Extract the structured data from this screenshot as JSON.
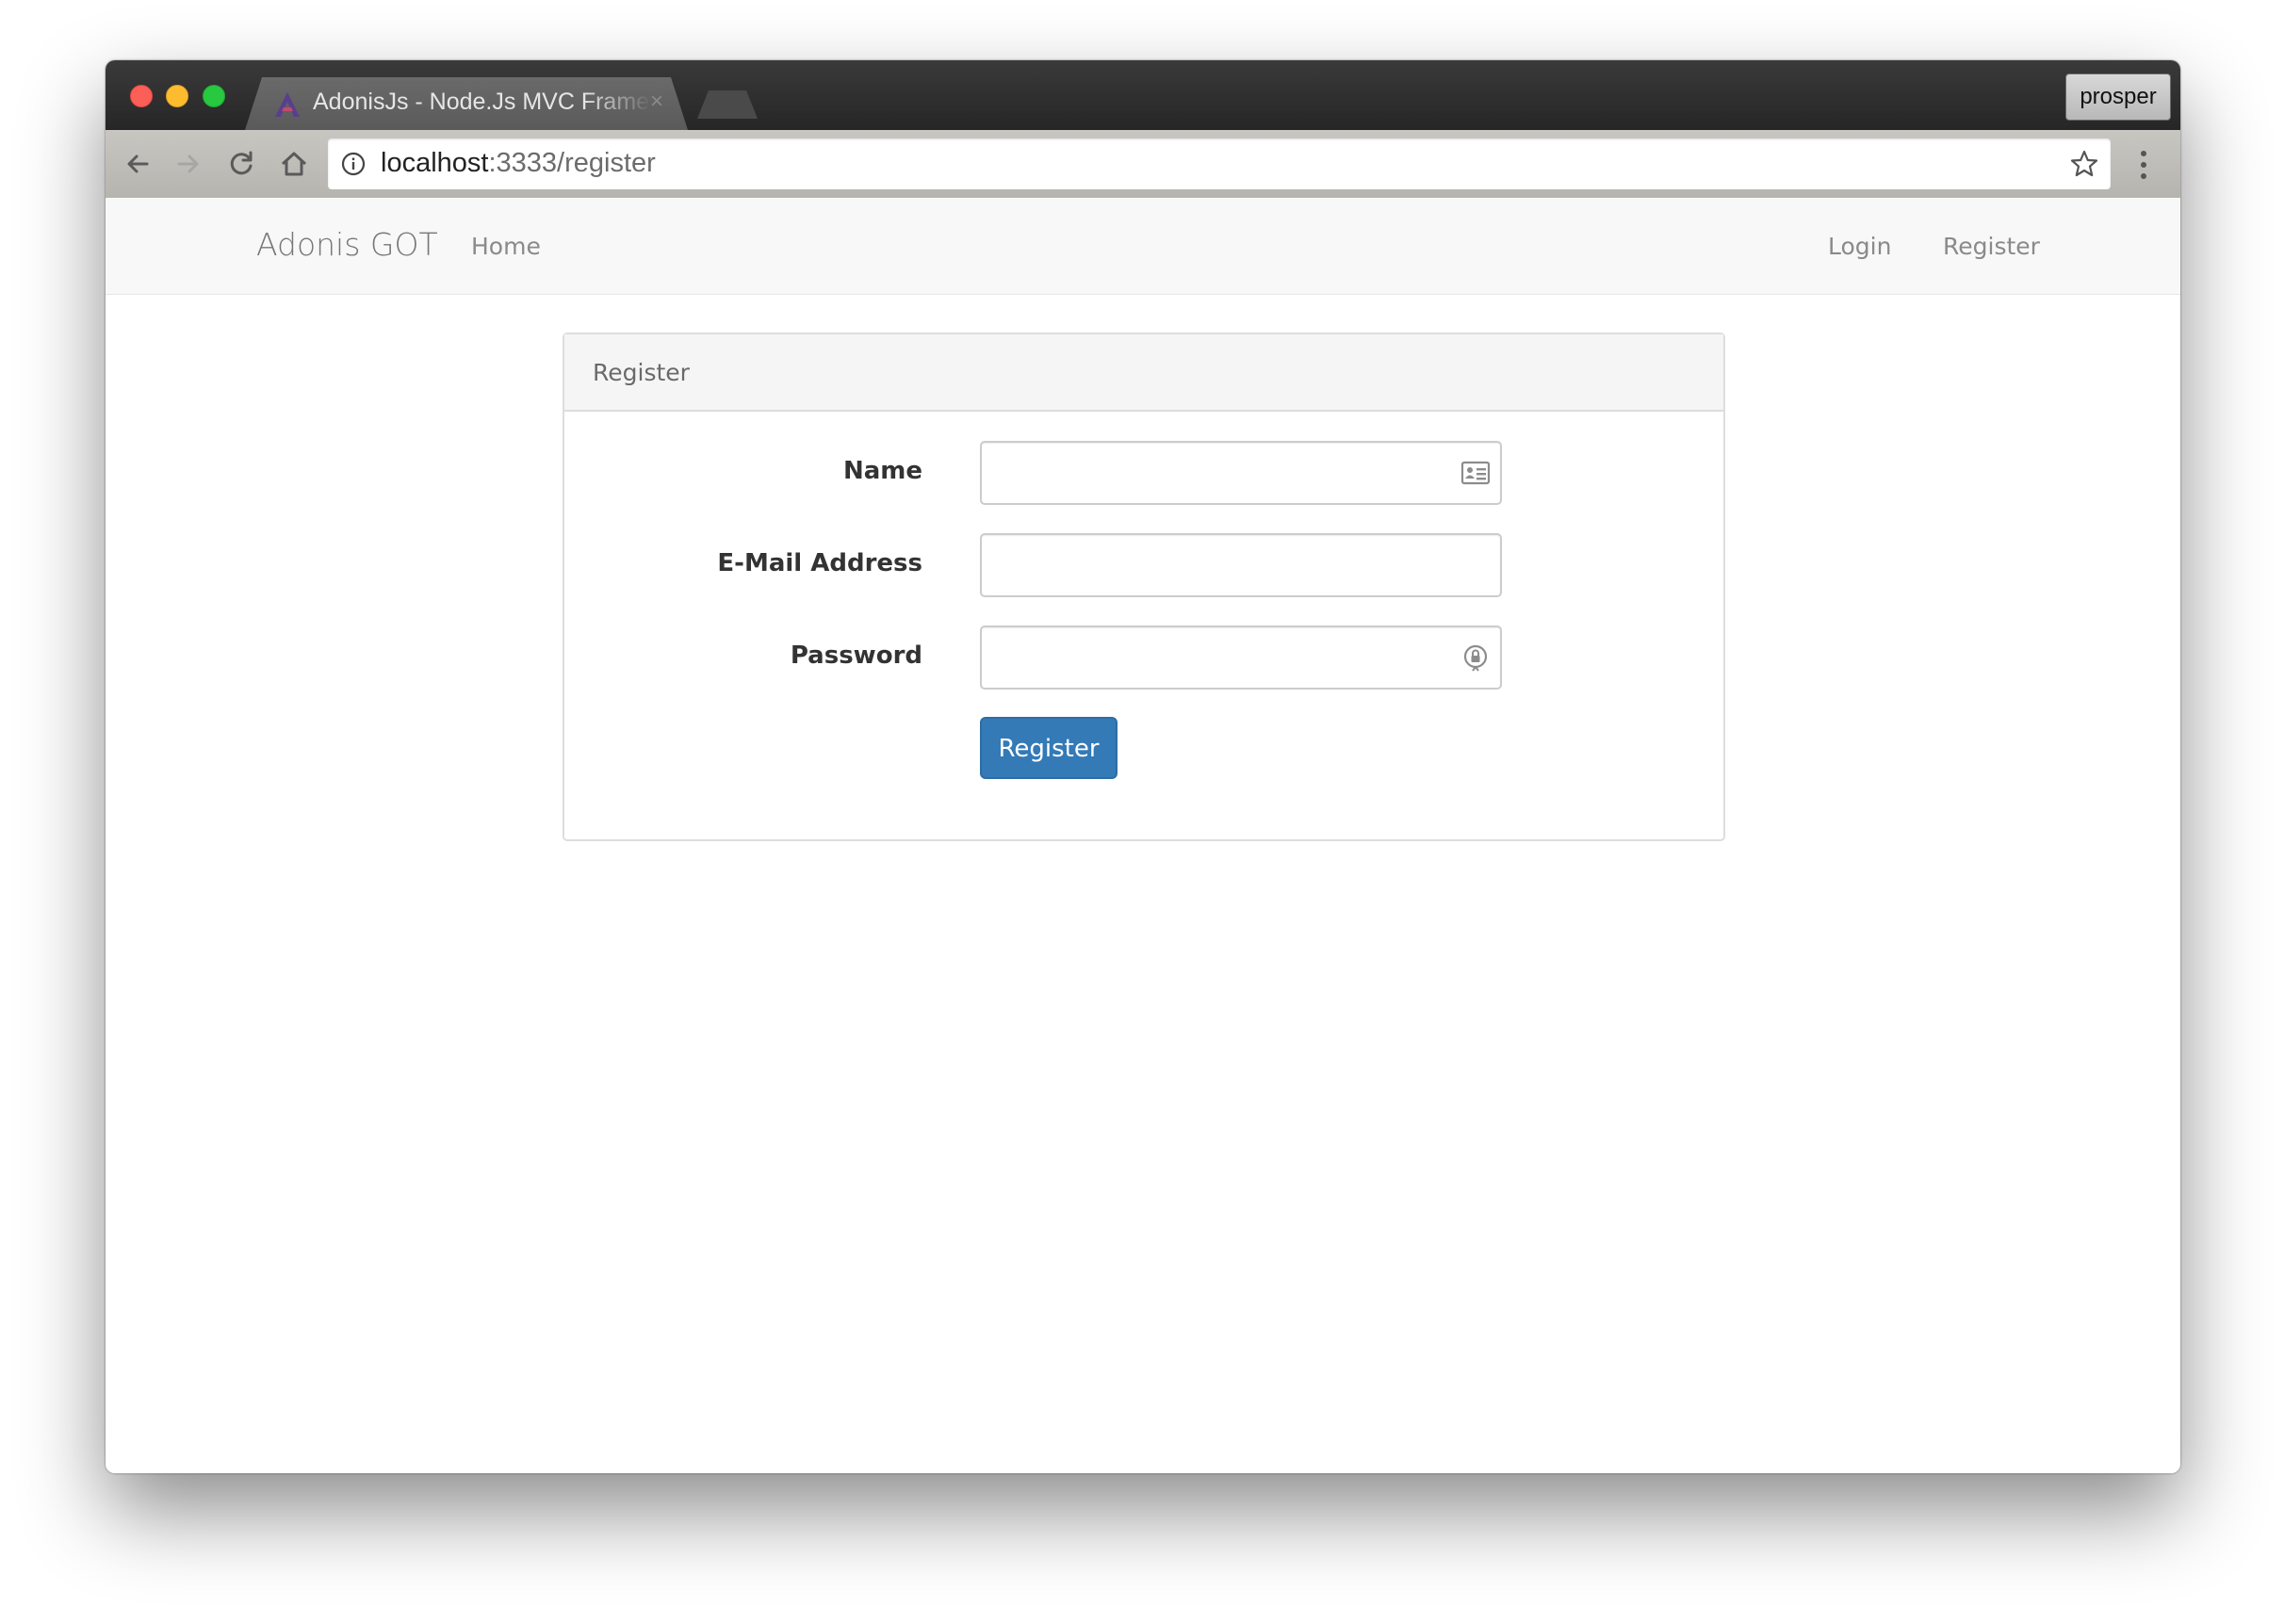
{
  "browser": {
    "tab_title": "AdonisJs - Node.Js MVC Framework",
    "tab_close": "×",
    "profile_name": "prosper",
    "url_host": "localhost",
    "url_path": ":3333/register"
  },
  "navbar": {
    "brand": "Adonis GOT",
    "home": "Home",
    "login": "Login",
    "register": "Register"
  },
  "panel": {
    "title": "Register",
    "fields": [
      {
        "label": "Name",
        "value": "",
        "placeholder": ""
      },
      {
        "label": "E-Mail Address",
        "value": "",
        "placeholder": ""
      },
      {
        "label": "Password",
        "value": "",
        "placeholder": ""
      }
    ],
    "submit_label": "Register"
  },
  "colors": {
    "primary_button": "#337ab7",
    "navbar_bg": "#f8f8f8",
    "panel_heading_bg": "#f5f5f5"
  },
  "icons": {
    "name_field": "contact-card-icon",
    "password_field": "password-manager-icon",
    "tab_logo": "adonis-logo-icon"
  }
}
